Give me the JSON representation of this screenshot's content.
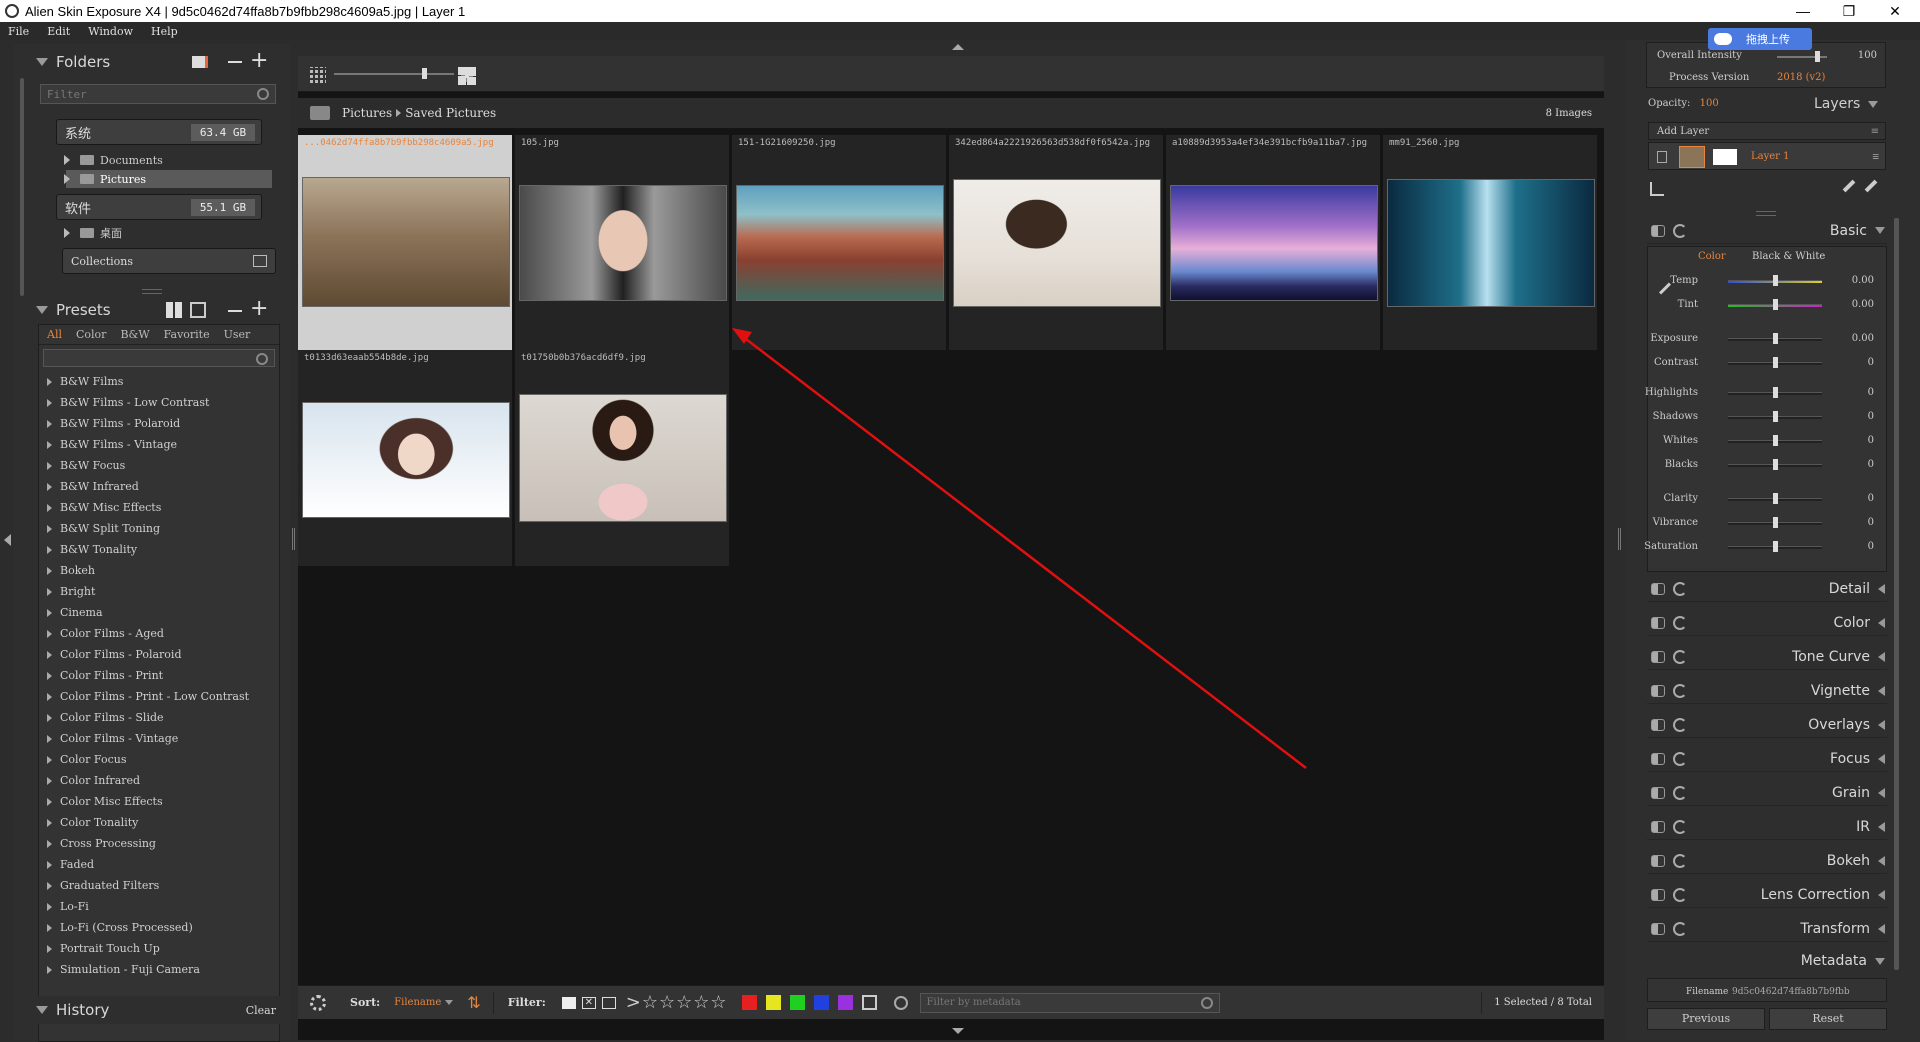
{
  "window": {
    "title": "Alien Skin Exposure X4 | 9d5c0462d74ffa8b7b9fbb298c4609a5.jpg | Layer 1",
    "controls": [
      "—",
      "❐",
      "✕"
    ]
  },
  "menu": [
    "File",
    "Edit",
    "Window",
    "Help"
  ],
  "folders": {
    "title": "Folders",
    "filter_placeholder": "Filter",
    "drives": [
      {
        "label": "系统",
        "capacity": "63.4 GB"
      },
      {
        "label": "软件",
        "capacity": "55.1 GB"
      }
    ],
    "items": [
      "Documents",
      "Pictures",
      "桌面"
    ],
    "collections": "Collections"
  },
  "presets": {
    "title": "Presets",
    "tabs": [
      "All",
      "Color",
      "B&W",
      "Favorite",
      "User"
    ],
    "items": [
      "B&W Films",
      "B&W Films - Low Contrast",
      "B&W Films - Polaroid",
      "B&W Films - Vintage",
      "B&W Focus",
      "B&W Infrared",
      "B&W Misc Effects",
      "B&W Split Toning",
      "B&W Tonality",
      "Bokeh",
      "Bright",
      "Cinema",
      "Color Films - Aged",
      "Color Films - Polaroid",
      "Color Films - Print",
      "Color Films - Print - Low Contrast",
      "Color Films - Slide",
      "Color Films - Vintage",
      "Color Focus",
      "Color Infrared",
      "Color Misc Effects",
      "Color Tonality",
      "Cross Processing",
      "Faded",
      "Graduated Filters",
      "Lo-Fi",
      "Lo-Fi (Cross Processed)",
      "Portrait Touch Up",
      "Simulation - Fuji Camera"
    ]
  },
  "history": {
    "title": "History",
    "clear": "Clear"
  },
  "browser": {
    "path": [
      "Pictures",
      "Saved Pictures"
    ],
    "count": "8 Images",
    "thumbs": [
      {
        "name": "...0462d74ffa8b7b9fbb298c4609a5.jpg"
      },
      {
        "name": "105.jpg"
      },
      {
        "name": "151-1G21609250.jpg"
      },
      {
        "name": "342ed864a2221926563d538df0f6542a.jpg"
      },
      {
        "name": "a10889d3953a4ef34e391bcfb9a11ba7.jpg"
      },
      {
        "name": "mm91_2560.jpg"
      },
      {
        "name": "t0133d63eaab554b8de.jpg"
      },
      {
        "name": "t01750b0b376acd6df9.jpg"
      }
    ]
  },
  "bottom": {
    "sort_label": "Sort:",
    "sort_value": "Filename",
    "filter_label": "Filter:",
    "filter_placeholder": "Filter by metadata",
    "status": "1 Selected / 8 Total",
    "color_labels": [
      "#e62020",
      "#e6e620",
      "#20d020",
      "#2040e0",
      "#9a30e0"
    ]
  },
  "right": {
    "overall_intensity_label": "Overall Intensity",
    "overall_intensity_value": "100",
    "process_version_label": "Process Version",
    "process_version_value": "2018 (v2)",
    "opacity_label": "Opacity:",
    "opacity_value": "100",
    "layers_title": "Layers",
    "add_layer": "Add Layer",
    "layer_name": "Layer 1",
    "upload_badge": "拖拽上传",
    "basic_title": "Basic",
    "mode_color": "Color",
    "mode_bw": "Black & White",
    "sliders": [
      {
        "label": "Temp",
        "value": "0.00"
      },
      {
        "label": "Tint",
        "value": "0.00"
      },
      {
        "label": "Exposure",
        "value": "0.00"
      },
      {
        "label": "Contrast",
        "value": "0"
      },
      {
        "label": "Highlights",
        "value": "0"
      },
      {
        "label": "Shadows",
        "value": "0"
      },
      {
        "label": "Whites",
        "value": "0"
      },
      {
        "label": "Blacks",
        "value": "0"
      },
      {
        "label": "Clarity",
        "value": "0"
      },
      {
        "label": "Vibrance",
        "value": "0"
      },
      {
        "label": "Saturation",
        "value": "0"
      }
    ],
    "sections": [
      "Detail",
      "Color",
      "Tone Curve",
      "Vignette",
      "Overlays",
      "Focus",
      "Grain",
      "IR",
      "Bokeh",
      "Lens Correction",
      "Transform"
    ],
    "metadata_title": "Metadata",
    "filename_label": "Filename",
    "filename_value": "9d5c0462d74ffa8b7b9fbb",
    "previous": "Previous",
    "reset": "Reset"
  }
}
